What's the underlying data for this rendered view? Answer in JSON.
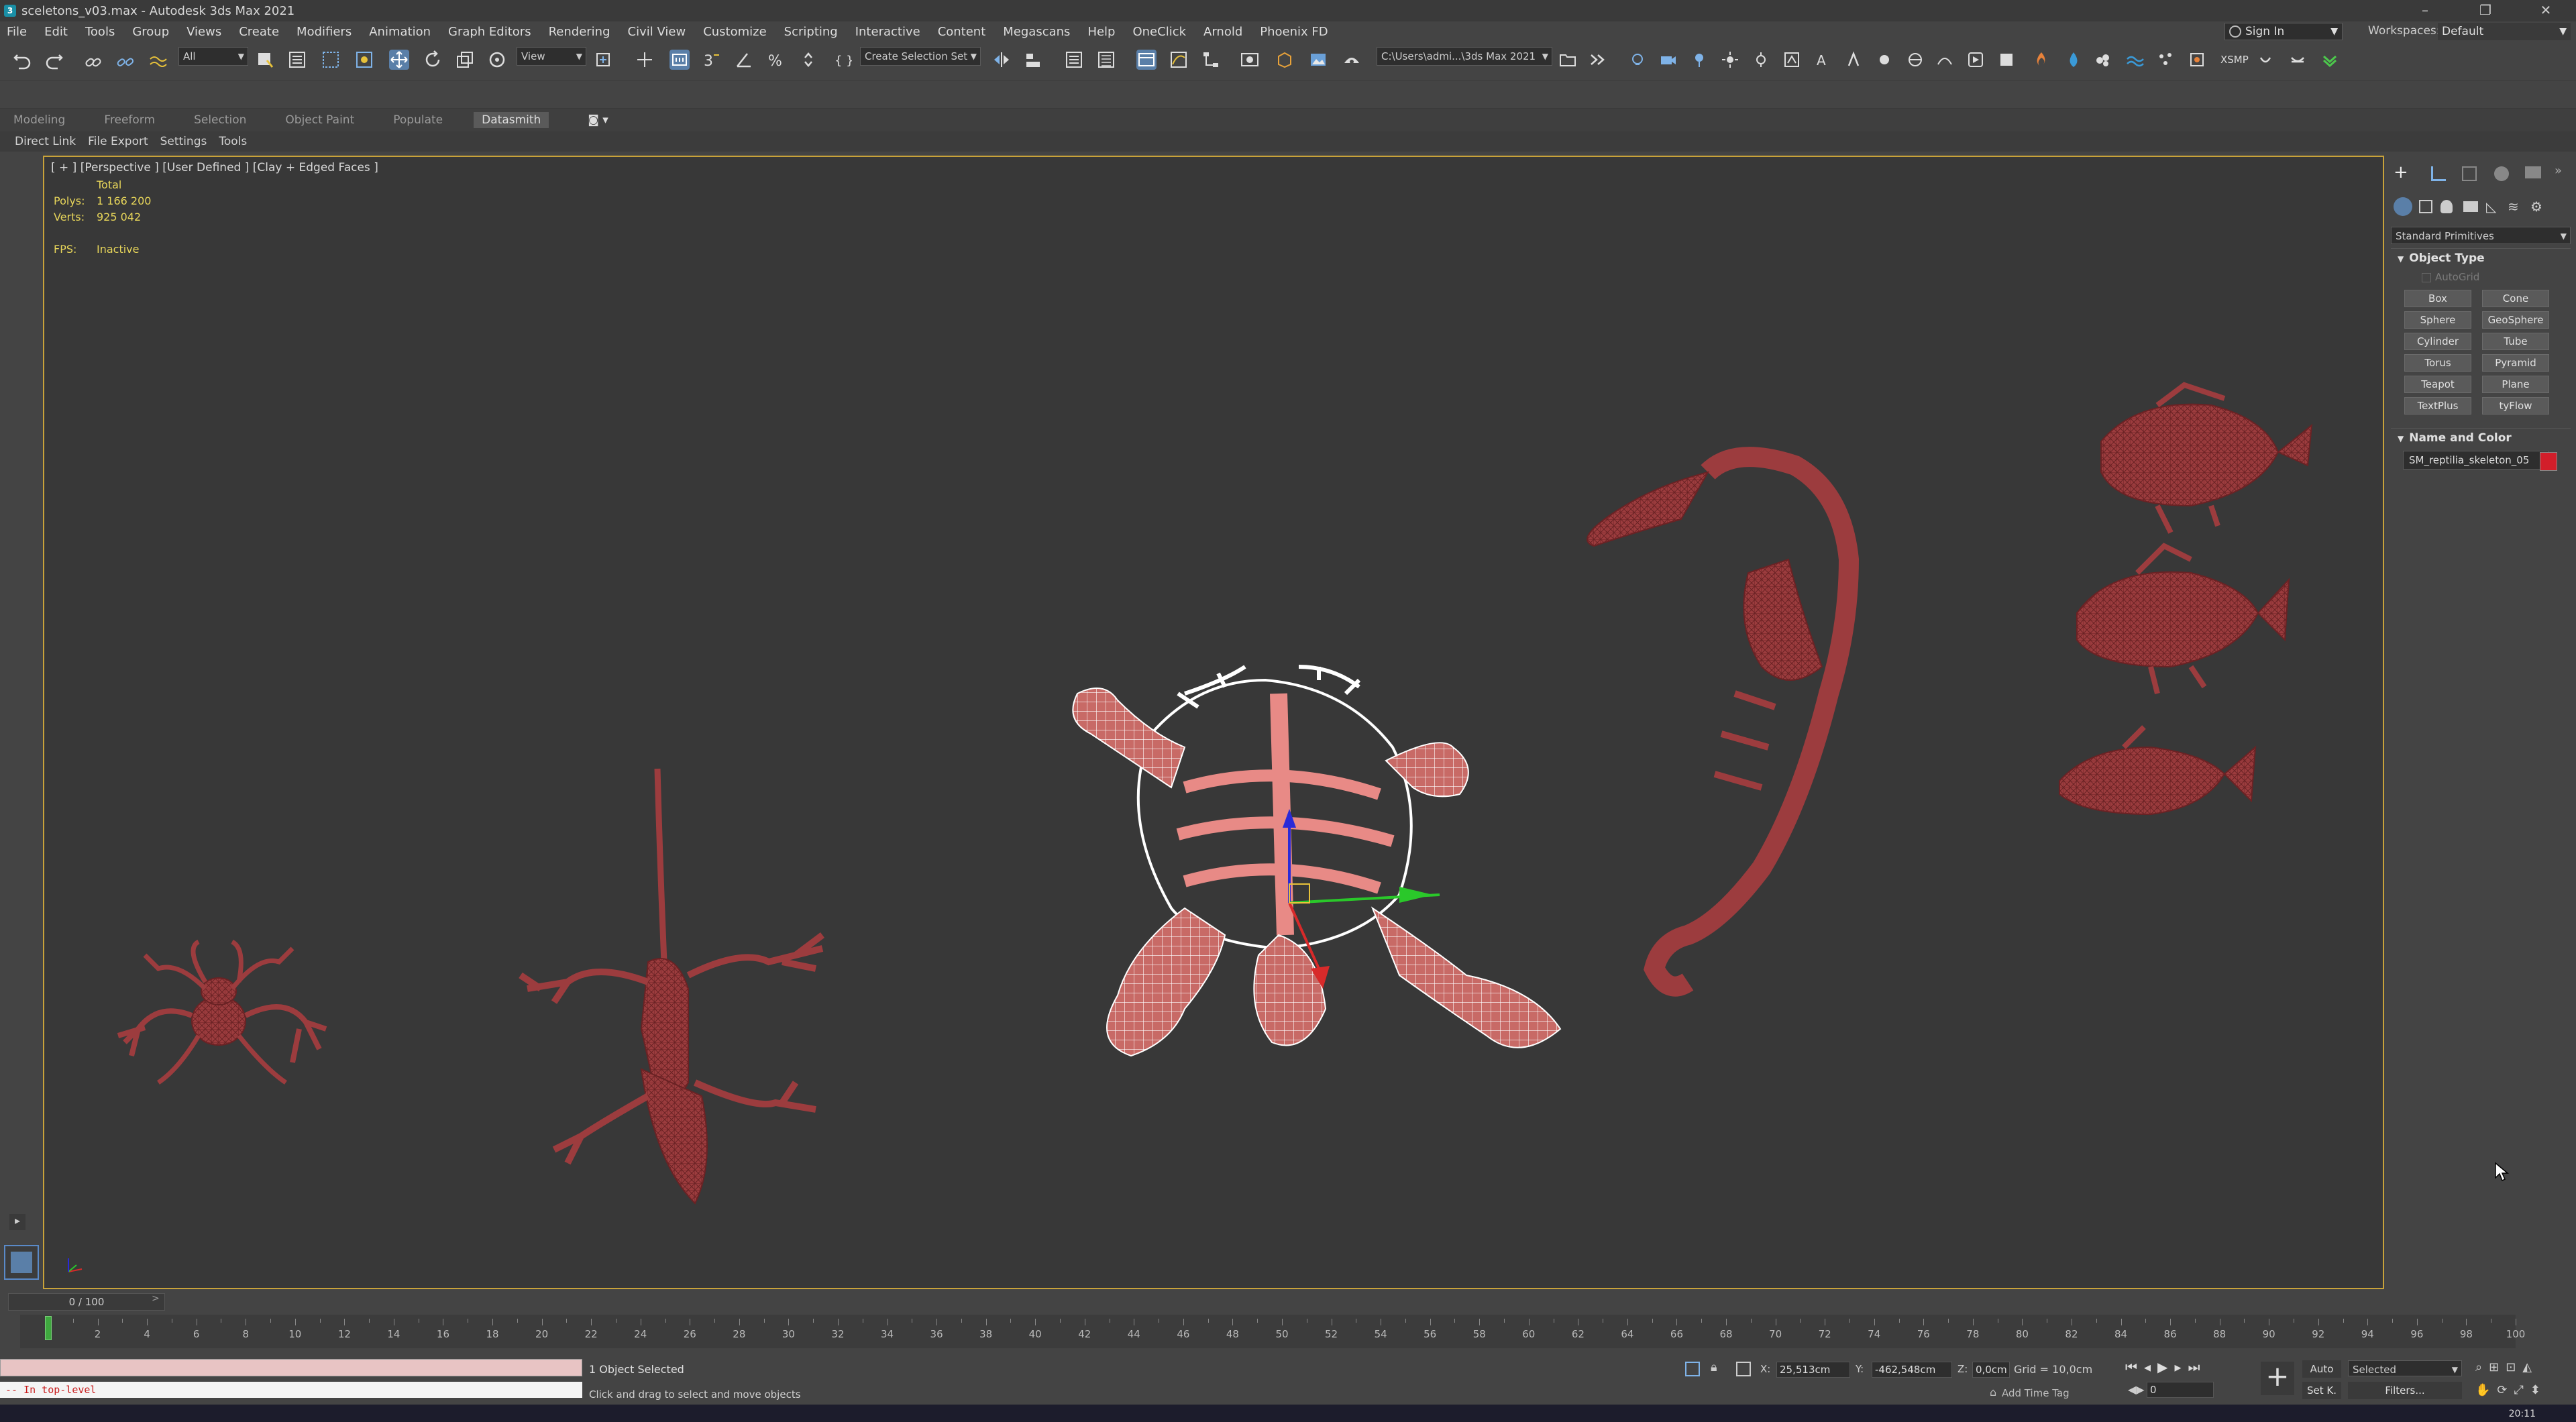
{
  "window": {
    "title": "sceletons_v03.max - Autodesk 3ds Max 2021",
    "controls": [
      "–",
      "❐",
      "✕"
    ]
  },
  "menu": [
    "File",
    "Edit",
    "Tools",
    "Group",
    "Views",
    "Create",
    "Modifiers",
    "Animation",
    "Graph Editors",
    "Rendering",
    "Civil View",
    "Customize",
    "Scripting",
    "Interactive",
    "Content",
    "Megascans",
    "Help",
    "OneClick",
    "Arnold",
    "Phoenix FD"
  ],
  "account": {
    "sign_in": "Sign In",
    "workspaces_label": "Workspaces:",
    "workspace": "Default"
  },
  "toolbar": {
    "selection_filter": "All",
    "ref_coord": "View",
    "selection_set": "Create Selection Set",
    "project_path": "C:\\Users\\admi...\\3ds Max 2021",
    "xsmp": "XSMP"
  },
  "ribbon": {
    "tabs": [
      "Modeling",
      "Freeform",
      "Selection",
      "Object Paint",
      "Populate",
      "Datasmith"
    ],
    "active_tab": "Datasmith",
    "datasmith_items": [
      "Direct Link",
      "File Export",
      "Settings",
      "Tools"
    ]
  },
  "viewport": {
    "label": "[ + ] [Perspective ] [User Defined ] [Clay + Edged Faces ]",
    "stats_header": "Total",
    "polys_label": "Polys:",
    "polys_value": "1 166 200",
    "verts_label": "Verts:",
    "verts_value": "925 042",
    "fps_label": "FPS:",
    "fps_value": "Inactive",
    "mesh_color": "#b8484a",
    "selected_color": "#e88a86"
  },
  "command_panel": {
    "category": "Standard Primitives",
    "object_type_title": "Object Type",
    "autogrid": "AutoGrid",
    "buttons": [
      "Box",
      "Cone",
      "Sphere",
      "GeoSphere",
      "Cylinder",
      "Tube",
      "Torus",
      "Pyramid",
      "Teapot",
      "Plane",
      "TextPlus",
      "tyFlow"
    ],
    "name_color_title": "Name and Color",
    "object_name": "SM_reptilia_skeleton_05",
    "object_color": "#d21e2a"
  },
  "timeline": {
    "slider": "0 / 100",
    "prev": "<",
    "next": ">",
    "ticks": [
      "0",
      "2",
      "4",
      "6",
      "8",
      "10",
      "12",
      "14",
      "16",
      "18",
      "20",
      "22",
      "24",
      "26",
      "28",
      "30",
      "32",
      "34",
      "36",
      "38",
      "40",
      "42",
      "44",
      "46",
      "48",
      "50",
      "52",
      "54",
      "56",
      "58",
      "60",
      "62",
      "64",
      "66",
      "68",
      "70",
      "72",
      "74",
      "76",
      "78",
      "80",
      "82",
      "84",
      "86",
      "88",
      "90",
      "92",
      "94",
      "96",
      "98",
      "100"
    ],
    "current_frame": 0
  },
  "status": {
    "selection": "1 Object Selected",
    "prompt": "Click and drag to select and move objects",
    "maxscript_output": "-- In top-level",
    "x_label": "X:",
    "x_value": "25,513cm",
    "y_label": "Y:",
    "y_value": "-462,548cm",
    "z_label": "Z:",
    "z_value": "0,0cm",
    "grid": "Grid = 10,0cm",
    "add_time_tag": "Add Time Tag",
    "auto_key": "Auto",
    "set_key": "Set K.",
    "key_filter": "Selected",
    "filters": "Filters...",
    "frame": "0",
    "clock": "20:11"
  }
}
